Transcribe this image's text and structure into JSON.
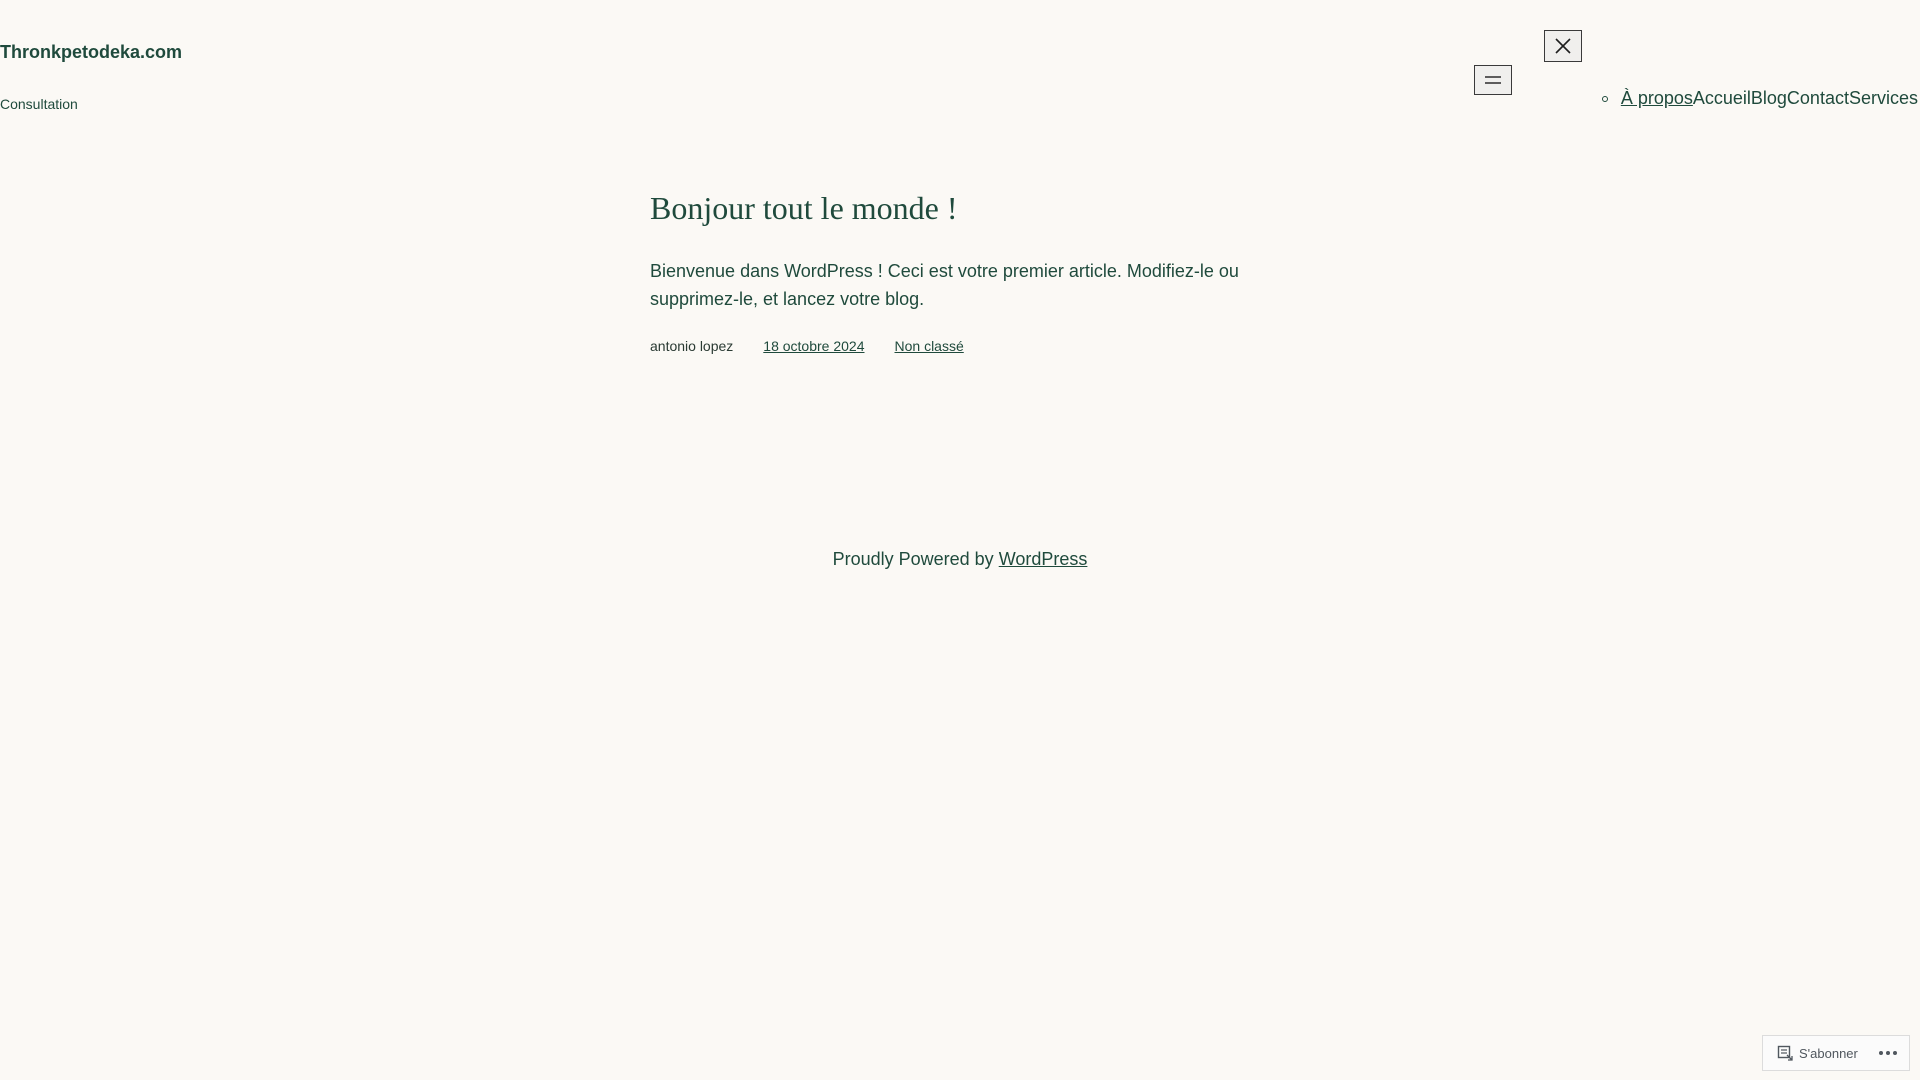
{
  "header": {
    "site_title": "Thronkpetodeka.com",
    "tagline": "Consultation",
    "open_menu_icon": "hamburger-icon",
    "close_menu_icon": "close-icon",
    "nav": [
      "À propos",
      "Accueil",
      "Blog",
      "Contact",
      "Services"
    ]
  },
  "post": {
    "title": "Bonjour tout le monde !",
    "content": "Bienvenue dans WordPress ! Ceci est votre premier article. Modifiez-le ou supprimez-le, et lancez votre blog.",
    "author": "antonio lopez",
    "date": "18 octobre 2024",
    "category": "Non classé"
  },
  "footer": {
    "prefix": "Proudly Powered by",
    "link": "WordPress"
  },
  "subscribe": {
    "label": "S'abonner",
    "icon": "reader-icon",
    "more_icon": "more-dots-icon"
  },
  "colors": {
    "background": "#fbf9f5",
    "text": "#1f4a3c"
  }
}
